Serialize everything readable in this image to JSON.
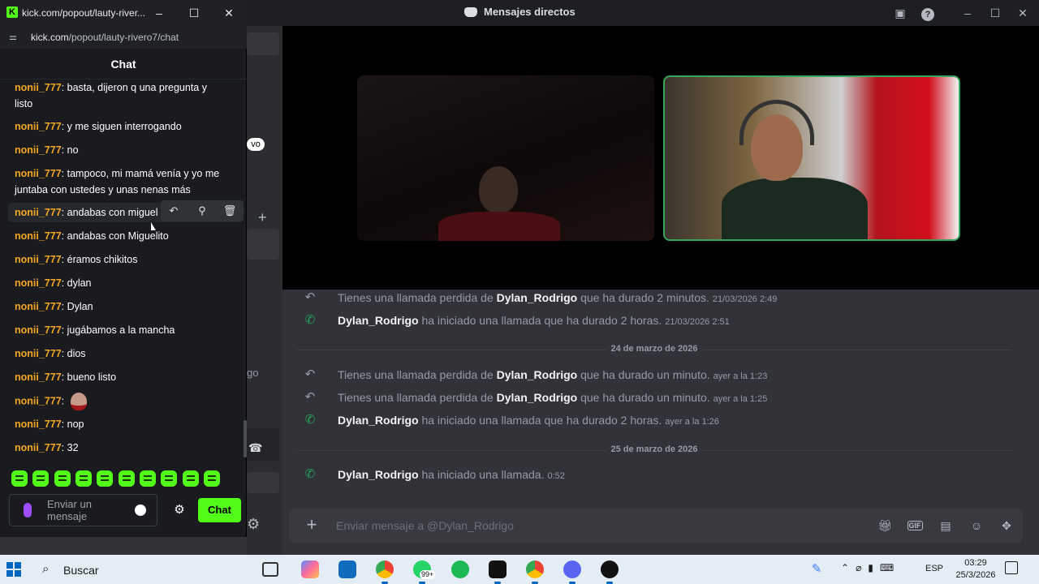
{
  "discord": {
    "window_title": "Mensajes directos",
    "ghost_labels": {
      "left_status": "vo",
      "left_text": "go"
    },
    "messages": [
      {
        "kind": "missed",
        "prefix": "Tienes una llamada perdida de ",
        "user": "Dylan_Rodrigo",
        "suffix": " que ha durado 2 minutos.",
        "time": "21/03/2026 2:49"
      },
      {
        "kind": "answered",
        "prefix": "",
        "user": "Dylan_Rodrigo",
        "suffix": " ha iniciado una llamada que ha durado 2 horas.",
        "time": "21/03/2026 2:51"
      },
      {
        "kind": "divider",
        "label": "24 de marzo de 2026"
      },
      {
        "kind": "missed",
        "prefix": "Tienes una llamada perdida de ",
        "user": "Dylan_Rodrigo",
        "suffix": " que ha durado un minuto.",
        "time": "ayer a la 1:23"
      },
      {
        "kind": "missed",
        "prefix": "Tienes una llamada perdida de ",
        "user": "Dylan_Rodrigo",
        "suffix": " que ha durado un minuto.",
        "time": "ayer a la 1:25"
      },
      {
        "kind": "answered",
        "prefix": "",
        "user": "Dylan_Rodrigo",
        "suffix": " ha iniciado una llamada que ha durado 2 horas.",
        "time": "ayer a la 1:26"
      },
      {
        "kind": "divider",
        "label": "25 de marzo de 2026"
      },
      {
        "kind": "answered",
        "prefix": "",
        "user": "Dylan_Rodrigo",
        "suffix": " ha iniciado una llamada.",
        "time": "0:52"
      }
    ],
    "composer_placeholder": "Enviar mensaje a @Dylan_Rodrigo",
    "composer_icons": [
      "gift-icon",
      "gif-icon",
      "sticker-icon",
      "emoji-icon",
      "apps-icon"
    ]
  },
  "kick": {
    "window_title": "kick.com/popout/lauty-river...",
    "url_host": "kick.com",
    "url_path": "/popout/lauty-rivero7/chat",
    "chat_header": "Chat",
    "lines": [
      {
        "user": "nonii_777",
        "text": "basta, dijeron q una pregunta y listo"
      },
      {
        "user": "nonii_777",
        "text": "y me siguen interrogando"
      },
      {
        "user": "nonii_777",
        "text": "no"
      },
      {
        "user": "nonii_777",
        "text": "tampoco, mi mamá venía y yo me juntaba con ustedes y unas nenas más"
      },
      {
        "user": "nonii_777",
        "text": "andabas con miguel"
      },
      {
        "user": "nonii_777",
        "text": "andabas con Miguelito"
      },
      {
        "user": "nonii_777",
        "text": "éramos chikitos"
      },
      {
        "user": "nonii_777",
        "text": "dylan"
      },
      {
        "user": "nonii_777",
        "text": "Dylan"
      },
      {
        "user": "nonii_777",
        "text": "jugábamos a la mancha"
      },
      {
        "user": "nonii_777",
        "text": "dios"
      },
      {
        "user": "nonii_777",
        "text": "bueno listo"
      },
      {
        "user": "nonii_777",
        "text": ""
      },
      {
        "user": "nonii_777",
        "text": "nop"
      },
      {
        "user": "nonii_777",
        "text": "32"
      }
    ],
    "input_placeholder": "Enviar un mensaje",
    "send_label": "Chat"
  },
  "taskbar": {
    "search_label": "Buscar",
    "whatsapp_badge": "99+",
    "language": "ESP",
    "time": "03:29",
    "date": "25/3/2026"
  }
}
